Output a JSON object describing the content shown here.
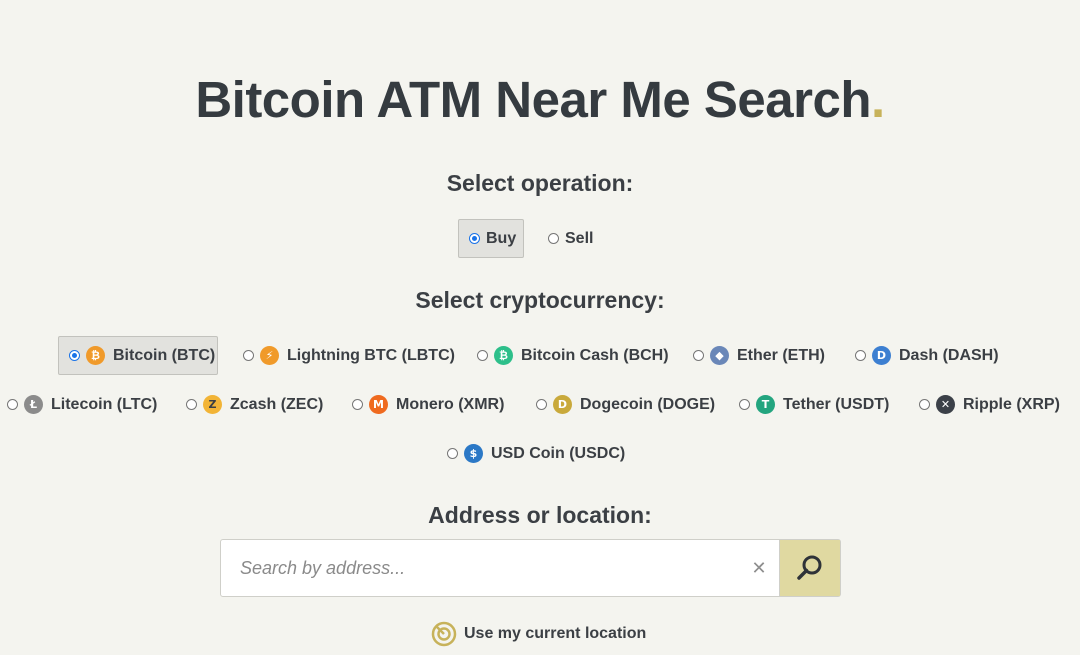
{
  "header": {
    "title": "Bitcoin ATM Near Me Search",
    "title_dot": ".",
    "accent_color": "#c7b25a"
  },
  "operation": {
    "label": "Select operation:",
    "selected": "Buy",
    "options": [
      {
        "label": "Buy"
      },
      {
        "label": "Sell"
      }
    ]
  },
  "crypto": {
    "label": "Select cryptocurrency:",
    "selected": "Bitcoin (BTC)",
    "options": [
      {
        "label": "Bitcoin (BTC)",
        "icon": "bitcoin-icon",
        "color": "#f09a2a",
        "glyph": "₿"
      },
      {
        "label": "Lightning BTC (LBTC)",
        "icon": "lightning-icon",
        "color": "#f09a2a",
        "glyph": "⚡"
      },
      {
        "label": "Bitcoin Cash (BCH)",
        "icon": "bitcoin-cash-icon",
        "color": "#2dbf8a",
        "glyph": "₿"
      },
      {
        "label": "Ether (ETH)",
        "icon": "ether-icon",
        "color": "#6a87b8",
        "glyph": "◆"
      },
      {
        "label": "Dash (DASH)",
        "icon": "dash-icon",
        "color": "#3c7fd1",
        "glyph": "D"
      },
      {
        "label": "Litecoin (LTC)",
        "icon": "litecoin-icon",
        "color": "#8b8b8b",
        "glyph": "Ł"
      },
      {
        "label": "Zcash (ZEC)",
        "icon": "zcash-icon",
        "color": "#f2b436",
        "glyph": "Z"
      },
      {
        "label": "Monero (XMR)",
        "icon": "monero-icon",
        "color": "#ef6a1f",
        "glyph": "M"
      },
      {
        "label": "Dogecoin (DOGE)",
        "icon": "dogecoin-icon",
        "color": "#c9a93b",
        "glyph": "D"
      },
      {
        "label": "Tether (USDT)",
        "icon": "tether-icon",
        "color": "#23a57f",
        "glyph": "T"
      },
      {
        "label": "Ripple (XRP)",
        "icon": "ripple-icon",
        "color": "#3b4048",
        "glyph": "✕"
      },
      {
        "label": "USD Coin (USDC)",
        "icon": "usdc-icon",
        "color": "#2b78c6",
        "glyph": "$"
      }
    ]
  },
  "address": {
    "label": "Address or location:",
    "placeholder": "Search by address...",
    "value": ""
  },
  "location": {
    "label": "Use my current location"
  }
}
